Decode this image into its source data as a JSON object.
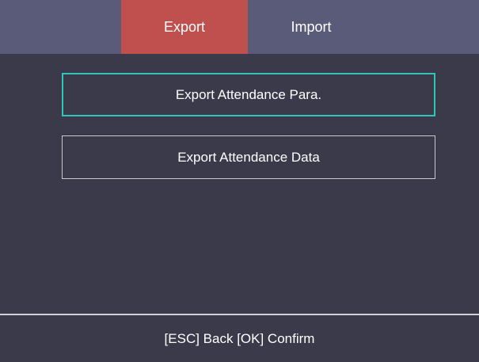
{
  "tabs": {
    "export_label": "Export",
    "import_label": "Import",
    "active": "Export"
  },
  "menu": {
    "items": [
      {
        "label": "Export Attendance Para.",
        "selected": true
      },
      {
        "label": "Export Attendance Data",
        "selected": false
      }
    ]
  },
  "footer": {
    "hint": "[ESC] Back [OK] Confirm"
  },
  "colors": {
    "background": "#3b3a4b",
    "tab_bar": "#595b79",
    "active_tab": "#c0504d",
    "selection_border": "#2fc6b8",
    "button_border": "#c9c9c9"
  }
}
